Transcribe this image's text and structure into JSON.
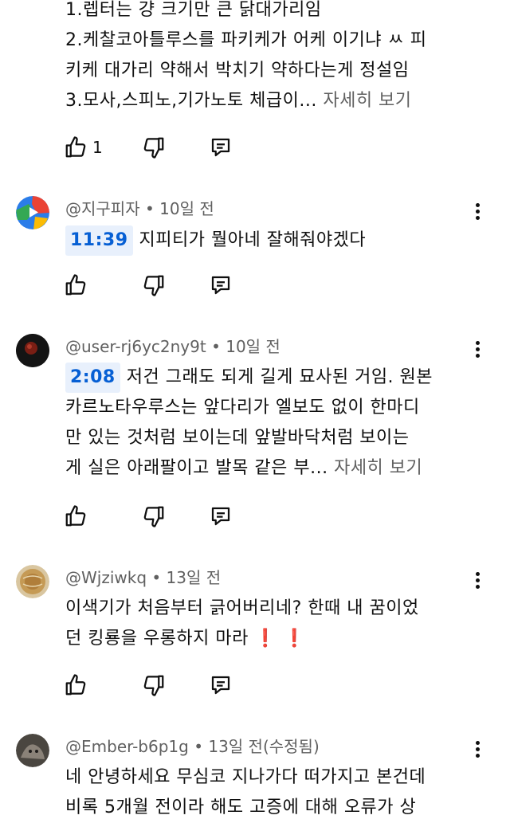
{
  "comments": [
    {
      "lines": [
        "1.렙터는 걍 크기만 큰 닭대가리임",
        "2.케찰코아틀루스를 파키케가 어케 이기냐 ㅆ 피",
        "키케 대가리 약해서 박치기 약하다는게 정설임",
        "3.모사,스피노,기가노토 체급이..."
      ],
      "more": "자세히 보기",
      "likes": "1"
    },
    {
      "author": "@지구피자",
      "time": "10일 전",
      "timestamp": "11:39",
      "lines": [
        "지피티가 뭘아네 잘해줘야겠다"
      ]
    },
    {
      "author": "@user-rj6yc2ny9t",
      "time": "10일 전",
      "timestamp": "2:08",
      "lines": [
        "저건 그래도 되게 길게 묘사된 거임. 원본",
        "카르노타우루스는 앞다리가 엘보도 없이 한마디",
        "만 있는 것처럼 보이는데 앞발바닥처럼 보이는",
        "게 실은 아래팔이고 발목 같은 부..."
      ],
      "more": "자세히 보기"
    },
    {
      "author": "@Wjziwkq",
      "time": "13일 전",
      "lines": [
        "이색기가 처음부터 긁어버리네? 한때 내 꿈이었",
        "던 킹룡을 우롱하지 마라"
      ],
      "emoji": "❗ ❗"
    },
    {
      "author": "@Ember-b6p1g",
      "time": "13일 전(수정됨)",
      "lines": [
        "네 안녕하세요 무심코 지나가다 떠가지고 본건데",
        "비록 5개월 전이라 해도 고증에 대해 오류가 상"
      ]
    }
  ],
  "separator": "•",
  "icons": [
    "like-icon",
    "dislike-icon",
    "reply-icon",
    "more-vert-icon"
  ],
  "colors": {
    "text": "#0f0f0f",
    "meta": "#606060",
    "timestamp_bg": "#e8f0fc",
    "timestamp_fg": "#065fd4",
    "emoji": "#e02020"
  }
}
